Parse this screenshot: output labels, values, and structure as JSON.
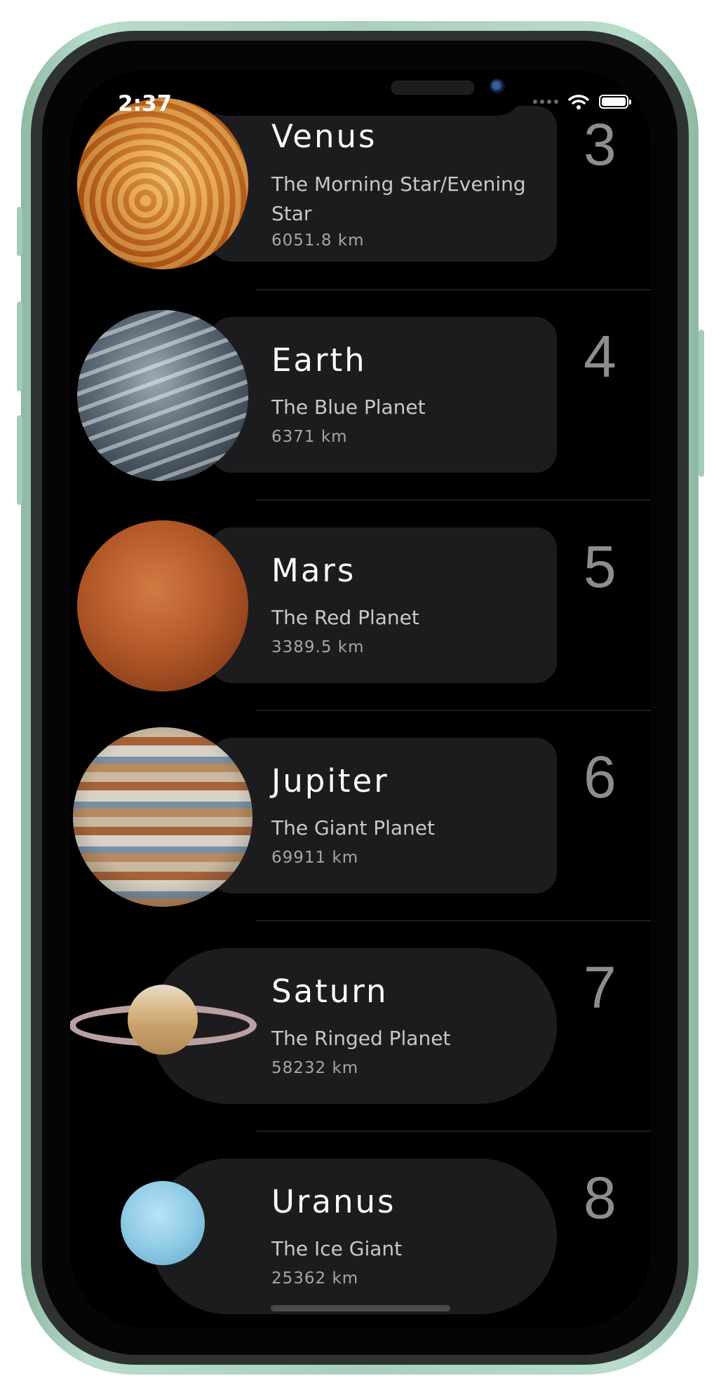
{
  "status_bar": {
    "time": "2:37"
  },
  "planets": [
    {
      "index": "3",
      "name": "Venus",
      "nickname": "The Morning Star/Evening Star",
      "size": "6051.8 km"
    },
    {
      "index": "4",
      "name": "Earth",
      "nickname": "The Blue Planet",
      "size": "6371 km"
    },
    {
      "index": "5",
      "name": "Mars",
      "nickname": "The Red Planet",
      "size": "3389.5 km"
    },
    {
      "index": "6",
      "name": "Jupiter",
      "nickname": "The Giant Planet",
      "size": "69911 km"
    },
    {
      "index": "7",
      "name": "Saturn",
      "nickname": "The Ringed Planet",
      "size": "58232 km"
    },
    {
      "index": "8",
      "name": "Uranus",
      "nickname": "The Ice Giant",
      "size": "25362 km"
    }
  ],
  "colors": {
    "card_background": "#1c1c1e",
    "index_text": "#8d8d8d",
    "frame": "#a9cfbc"
  }
}
